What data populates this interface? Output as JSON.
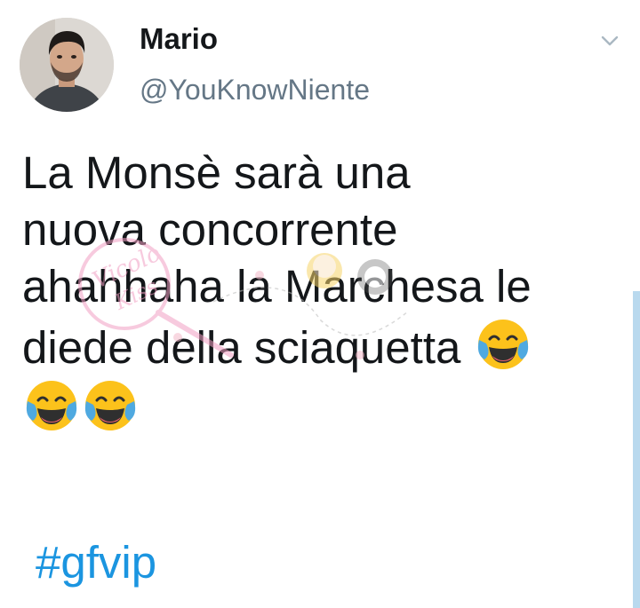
{
  "tweet": {
    "display_name": "Mario",
    "handle": "@YouKnowNiente",
    "text_lines": [
      "La Monsè sarà una",
      "nuova concorrente",
      "ahahhaha la Marchesa le",
      "diede della sciaquetta"
    ],
    "hashtag": "#gfvip",
    "emoji": "face-with-tears-of-joy",
    "emoji_count": 3
  },
  "icons": {
    "menu": "chevron-down-icon",
    "avatar": "profile-photo"
  },
  "watermark": {
    "text": "Vicolo Kiss"
  },
  "colors": {
    "text": "#14171a",
    "handle": "#657786",
    "hashtag": "#1b95e0",
    "chevron": "#aab8c2",
    "emoji_face": "#fcc21b",
    "emoji_tears": "#4fa9e0"
  }
}
